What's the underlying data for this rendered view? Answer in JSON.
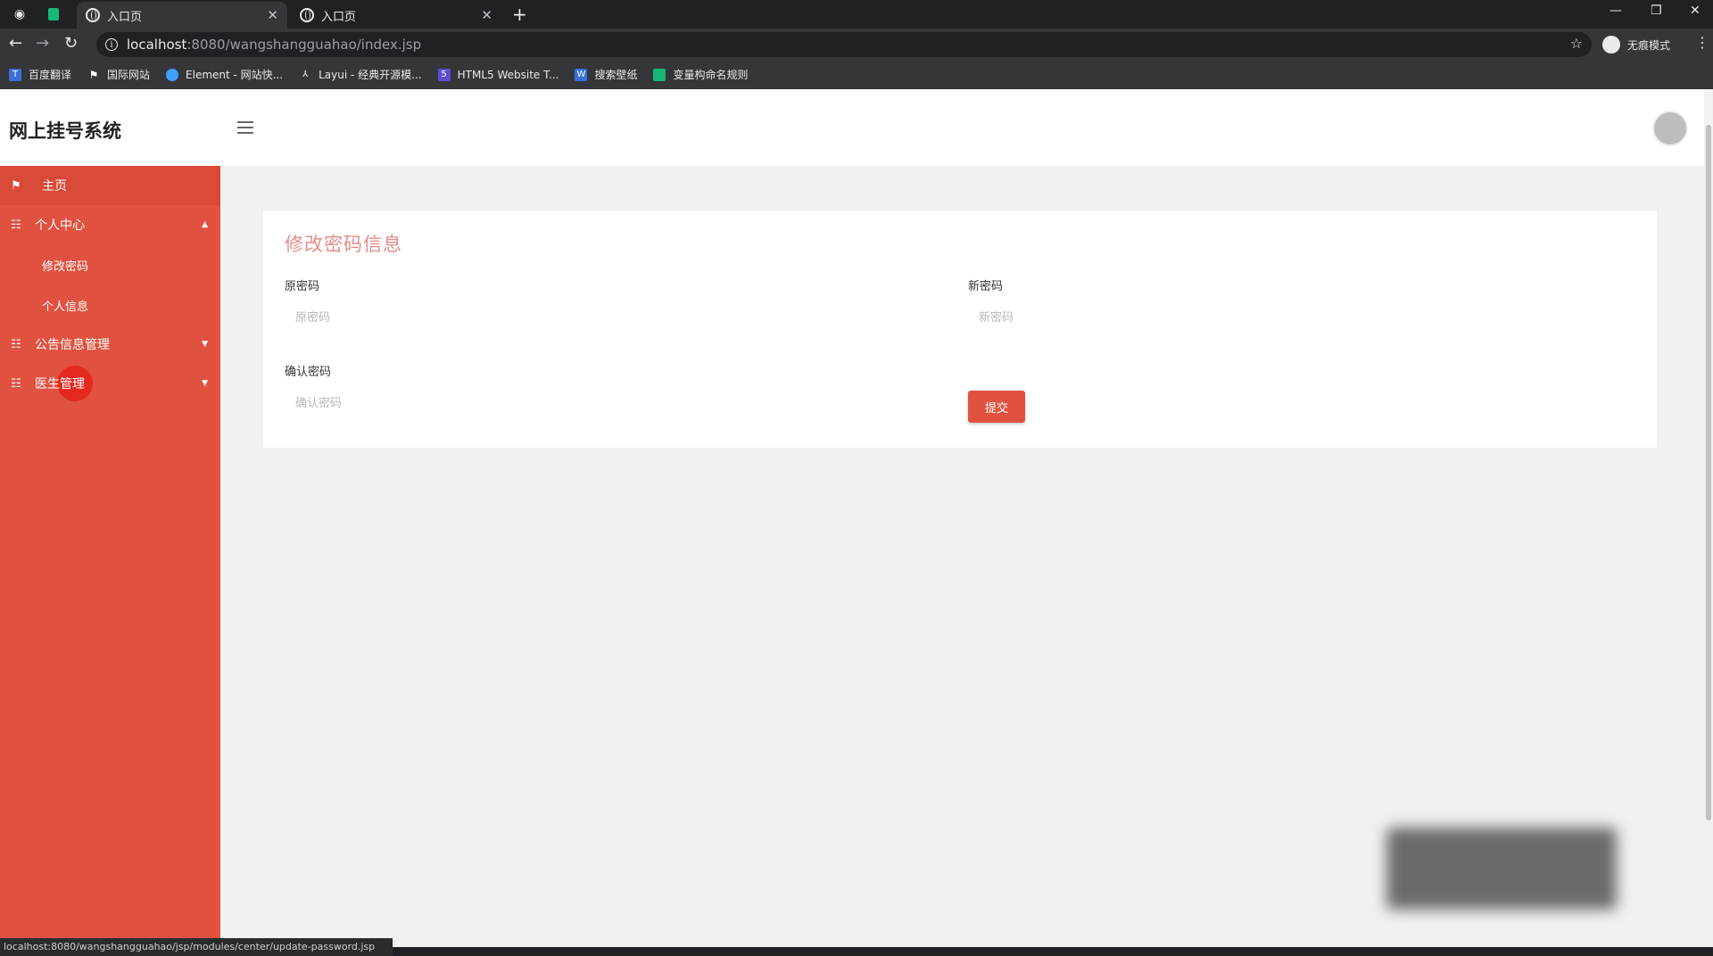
{
  "browser": {
    "tabs": [
      {
        "title": "入口页",
        "active": true
      },
      {
        "title": "入口页",
        "active": false
      }
    ],
    "url_host": "localhost",
    "url_rest": ":8080/wangshangguahao/index.jsp",
    "incognito_label": "无痕模式",
    "bookmarks": [
      {
        "label": "百度翻译",
        "color": "#3b6fd8"
      },
      {
        "label": "国际网站",
        "color": "#ffffff"
      },
      {
        "label": "Element - 网站快...",
        "color": "#409eff"
      },
      {
        "label": "Layui - 经典开源模...",
        "color": "#35363a"
      },
      {
        "label": "HTML5 Website T...",
        "color": "#5b4fd8"
      },
      {
        "label": "搜索壁纸",
        "color": "#3b6fd8"
      },
      {
        "label": "变量构命名规则",
        "color": "#16b777"
      }
    ],
    "status_url": "localhost:8080/wangshangguahao/jsp/modules/center/update-password.jsp"
  },
  "header": {
    "title": "网上挂号系统"
  },
  "sidebar": {
    "items": [
      {
        "label": "主页"
      },
      {
        "label": "个人中心"
      },
      {
        "label": "公告信息管理"
      },
      {
        "label": "医生管理"
      }
    ],
    "sub_items": [
      {
        "label": "修改密码"
      },
      {
        "label": "个人信息"
      }
    ]
  },
  "form": {
    "title": "修改密码信息",
    "old_password_label": "原密码",
    "old_password_placeholder": "原密码",
    "new_password_label": "新密码",
    "new_password_placeholder": "新密码",
    "confirm_password_label": "确认密码",
    "confirm_password_placeholder": "确认密码",
    "submit_label": "提交"
  },
  "colors": {
    "sidebar_bg": "#e0523f",
    "accent": "#e0523f",
    "title_color": "#e48b86"
  }
}
